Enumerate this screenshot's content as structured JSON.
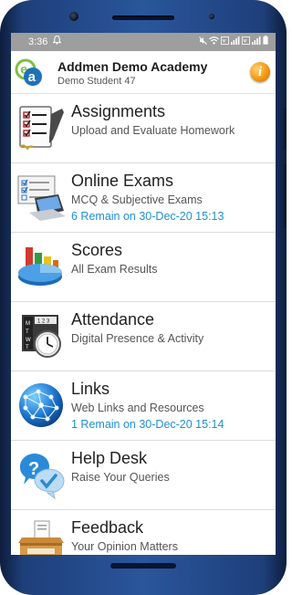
{
  "status_bar": {
    "time": "3:36",
    "right_icons": [
      "mute-icon",
      "wifi-icon",
      "volte-icon",
      "signal-icon",
      "volte-icon",
      "signal-icon",
      "battery-icon"
    ]
  },
  "header": {
    "title": "Addmen Demo Academy",
    "subtitle": "Demo Student 47",
    "logo": "addmen-logo",
    "info_label": "i"
  },
  "menu": [
    {
      "title": "Assignments",
      "subtitle": "Upload and Evaluate Homework",
      "remark": "",
      "icon": "assignment-checklist-icon"
    },
    {
      "title": "Online Exams",
      "subtitle": "MCQ & Subjective Exams",
      "remark": "6 Remain on 30-Dec-20 15:13",
      "icon": "laptop-exam-icon"
    },
    {
      "title": "Scores",
      "subtitle": "All Exam Results",
      "remark": "",
      "icon": "chart-scores-icon"
    },
    {
      "title": "Attendance",
      "subtitle": "Digital Presence & Activity",
      "remark": "",
      "icon": "calendar-clock-icon"
    },
    {
      "title": "Links",
      "subtitle": "Web Links and Resources",
      "remark": "1 Remain on 30-Dec-20 15:14",
      "icon": "globe-network-icon"
    },
    {
      "title": "Help Desk",
      "subtitle": "Raise Your Queries",
      "remark": "",
      "icon": "question-check-icon"
    },
    {
      "title": "Feedback",
      "subtitle": "Your Opinion Matters",
      "remark": "",
      "icon": "feedback-box-icon"
    }
  ],
  "colors": {
    "status_bar": "#9e9e9e",
    "remark": "#1e8fd8",
    "phone_frame": "#2a569c"
  }
}
